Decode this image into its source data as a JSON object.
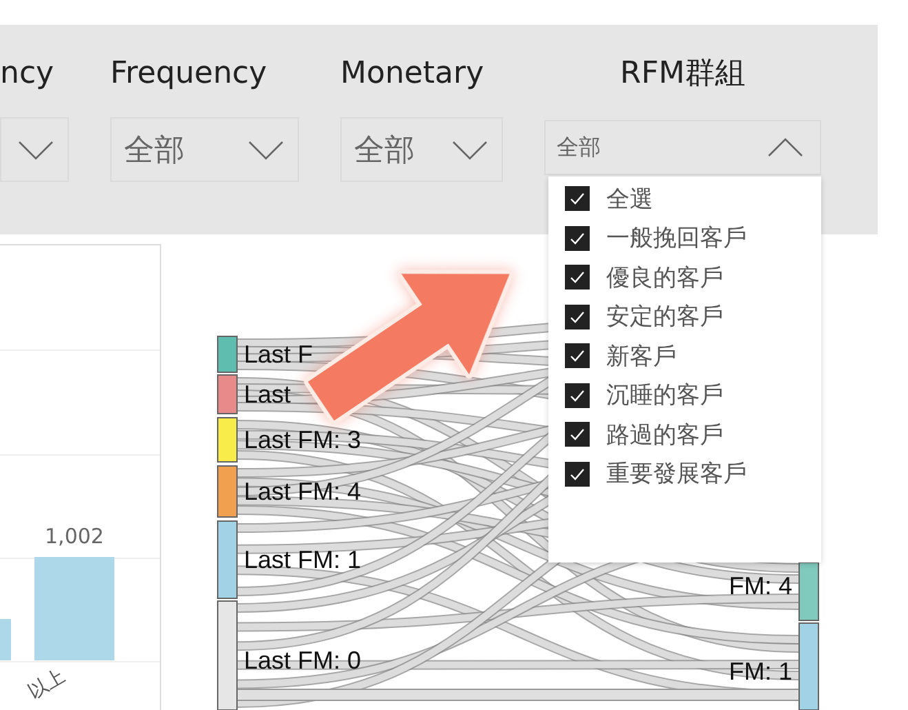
{
  "slicers": [
    {
      "kind": "large",
      "title": "ncy",
      "expanded": false
    },
    {
      "kind": "large",
      "title": "Frequency",
      "value": "全部",
      "expanded": false
    },
    {
      "kind": "large",
      "title": "Monetary",
      "value": "全部",
      "expanded": false
    },
    {
      "kind": "compact",
      "title": "RFM群組",
      "value": "全部",
      "expanded": true
    }
  ],
  "dropdown": {
    "items": [
      {
        "label": "全選",
        "checked": true
      },
      {
        "label": "一般挽回客戶",
        "checked": true
      },
      {
        "label": "優良的客戶",
        "checked": true
      },
      {
        "label": "安定的客戶",
        "checked": true
      },
      {
        "label": "新客戶",
        "checked": true
      },
      {
        "label": "沉睡的客戶",
        "checked": true
      },
      {
        "label": "路過的客戶",
        "checked": true
      },
      {
        "label": "重要發展客戶",
        "checked": true
      }
    ]
  },
  "bar_chart": {
    "data_label": "1,002",
    "category_label": "以上"
  },
  "sankey": {
    "source_nodes": [
      {
        "label": "Last F",
        "color": "#5fbdb0"
      },
      {
        "label": "Last",
        "color": "#e88a8a"
      },
      {
        "label": "Last FM: 3",
        "color": "#f7ec4a"
      },
      {
        "label": "Last FM: 4",
        "color": "#f0a04e"
      },
      {
        "label": "Last FM: 1",
        "color": "#a2d2e6"
      },
      {
        "label": "Last FM: 0",
        "color": "#e6e6e6"
      }
    ],
    "target_nodes": [
      {
        "label": "FM: 4",
        "color": "#7fc9bd"
      },
      {
        "label": "FM: 1",
        "color": "#a2d2e6"
      }
    ]
  }
}
